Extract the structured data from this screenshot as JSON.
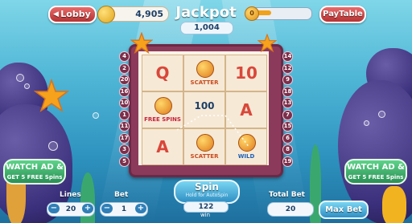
{
  "top": {
    "lobby_label": "Lobby",
    "coins": "4,905",
    "jackpot_label": "Jackpot",
    "jackpot_value": "1,004",
    "progress_value": "0",
    "paytable_label": "PayTable"
  },
  "reels": {
    "cells": [
      {
        "text": "Q",
        "color": "#d9473a"
      },
      {
        "text": "SCATTER",
        "color": "#c84b1f"
      },
      {
        "text": "10",
        "color": "#d9473a"
      },
      {
        "text": "FREE SPINS",
        "color": "#c8223a"
      },
      {
        "text": "100",
        "color": "#1d3f66"
      },
      {
        "text": "A",
        "color": "#d9473a"
      },
      {
        "text": "A",
        "color": "#d9473a"
      },
      {
        "text": "SCATTER",
        "color": "#c84b1f"
      },
      {
        "text": "WILD",
        "color": "#1f60b5"
      }
    ]
  },
  "lines_left": [
    "4",
    "2",
    "20",
    "16",
    "10",
    "1",
    "11",
    "17",
    "3",
    "5"
  ],
  "lines_right": [
    "14",
    "12",
    "9",
    "18",
    "13",
    "7",
    "15",
    "6",
    "8",
    "19"
  ],
  "watch_ad_left": {
    "line1": "WATCH AD &",
    "line2": "GET 5 FREE Spins"
  },
  "watch_ad_right": {
    "line1": "WATCH AD &",
    "line2": "GET 5 FREE Spins"
  },
  "controls": {
    "lines_label": "Lines",
    "lines_value": "20",
    "bet_label": "Bet",
    "bet_value": "1",
    "spin_label": "Spin",
    "spin_hint": "Hold for AutoSpin",
    "win_value": "122",
    "win_label": "win",
    "total_bet_label": "Total Bet",
    "total_bet_value": "20",
    "max_bet_label": "Max Bet",
    "minus": "−",
    "plus": "+"
  },
  "colors": {
    "frame": "#8c3a5c",
    "accent_red": "#c0392b",
    "accent_green": "#2a8f55",
    "accent_blue": "#2f7fb8"
  }
}
